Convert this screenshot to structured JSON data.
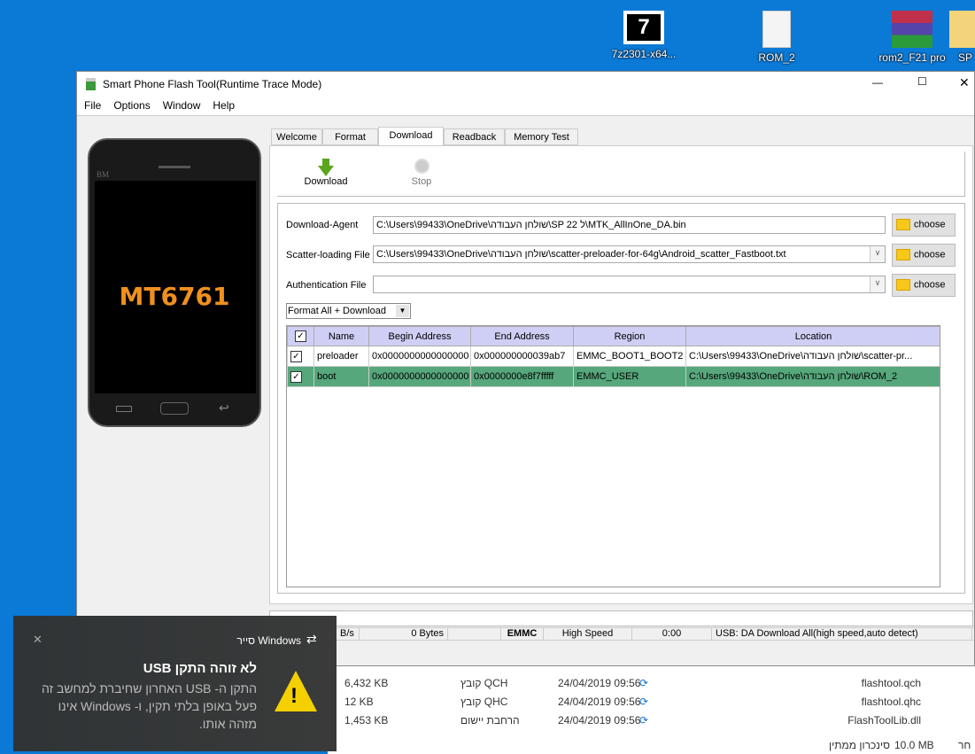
{
  "desktop": {
    "icons": [
      {
        "label": "7z2301-x64...",
        "icon": "7zip-installer-icon"
      },
      {
        "label": "ROM_2",
        "icon": "file-icon"
      },
      {
        "label": "rom2_F21 pro",
        "icon": "winrar-archive-icon"
      },
      {
        "label": "SP",
        "icon": "folder-icon"
      }
    ]
  },
  "window": {
    "title": "Smart Phone Flash Tool(Runtime Trace Mode)",
    "controls": {
      "minimize": "—",
      "maximize": "☐",
      "close": "✕"
    }
  },
  "menu": [
    "File",
    "Options",
    "Window",
    "Help"
  ],
  "phone": {
    "brand": "BM",
    "chip": "MT6761"
  },
  "tabs": [
    {
      "label": "Welcome"
    },
    {
      "label": "Format"
    },
    {
      "label": "Download",
      "active": true
    },
    {
      "label": "Readback"
    },
    {
      "label": "Memory Test"
    }
  ],
  "toolbar": {
    "download": "Download",
    "stop": "Stop"
  },
  "form": {
    "download_agent": {
      "label": "Download-Agent",
      "value": "C:\\Users\\99433\\OneDrive\\שולחן העבודה\\SP 22 ל\\MTK_AllInOne_DA.bin",
      "button": "choose"
    },
    "scatter": {
      "label": "Scatter-loading File",
      "value": "C:\\Users\\99433\\OneDrive\\שולחן העבודה\\scatter-preloader-for-64g\\Android_scatter_Fastboot.txt",
      "button": "choose"
    },
    "auth": {
      "label": "Authentication File",
      "value": "",
      "button": "choose"
    },
    "mode": "Format All + Download"
  },
  "table": {
    "headers": [
      "Name",
      "Begin Address",
      "End Address",
      "Region",
      "Location"
    ],
    "rows": [
      {
        "checked": true,
        "name": "preloader",
        "begin": "0x0000000000000000",
        "end": "0x000000000039ab7",
        "region": "EMMC_BOOT1_BOOT2",
        "location": "C:\\Users\\99433\\OneDrive\\שולחן העבודה\\scatter-pr..."
      },
      {
        "checked": true,
        "selected": true,
        "name": "boot",
        "begin": "0x0000000000000000",
        "end": "0x0000000e8f7fffff",
        "region": "EMMC_USER",
        "location": "C:\\Users\\99433\\OneDrive\\שולחן העבודה\\ROM_2"
      }
    ]
  },
  "status": {
    "rate": "B/s",
    "bytes": "0 Bytes",
    "blank": "",
    "storage": "EMMC",
    "speed": "High Speed",
    "time": "0:00",
    "message": "USB: DA Download All(high speed,auto detect)"
  },
  "explorer": {
    "files": [
      {
        "size": "6,432 KB",
        "type": "קובץ QCH",
        "date": "24/04/2019 09:56",
        "name": "flashtool.qch"
      },
      {
        "size": "12 KB",
        "type": "קובץ QHC",
        "date": "24/04/2019 09:56",
        "name": "flashtool.qhc"
      },
      {
        "size": "1,453 KB",
        "type": "הרחבת יישום",
        "date": "24/04/2019 09:56",
        "name": "FlashToolLib.dll"
      }
    ],
    "footer": {
      "size": "10.0 MB",
      "sync": "סינכרון ממתין",
      "partial": "חר"
    }
  },
  "toast": {
    "source": "סייר Windows",
    "title": "לא זוהה התקן USB",
    "body": "התקן ה- USB האחרון שחיברת למחשב זה פעל באופן בלתי תקין, ו- Windows אינו מזהה אותו.",
    "close": "✕"
  },
  "colors": {
    "desktop": "#0b79d6",
    "selected_row": "#56a77b",
    "table_header": "#cfcff5",
    "chip_text": "#f0901e"
  }
}
